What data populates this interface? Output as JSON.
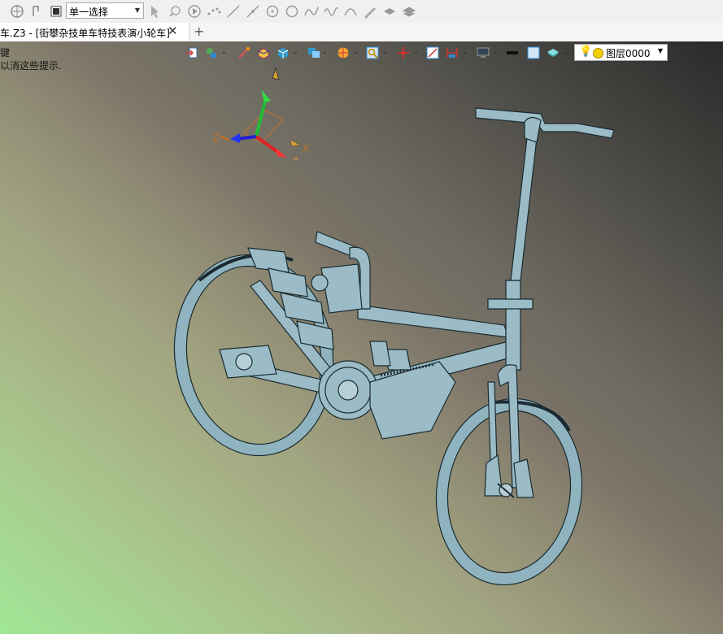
{
  "toolbar": {
    "select_value": "单一选择",
    "icons": [
      "globe-icon",
      "undo-icon",
      "stop-icon",
      "pointer-icon",
      "pick-icon",
      "play-icon",
      "points-icon",
      "line-icon",
      "line2-icon",
      "circle-dot-icon",
      "circle-icon",
      "curve-icon",
      "wave-icon",
      "arc-icon",
      "pen-icon",
      "layer-icon",
      "stack-icon"
    ]
  },
  "tabs": [
    {
      "title": "车.Z3 - [街攀杂技单车特技表演小轮车]",
      "close": "✕"
    }
  ],
  "add_tab": "+",
  "prompt": {
    "line1": "键",
    "line2": "以消这些提示."
  },
  "view_toolbar": {
    "layer_label": "图层0000"
  },
  "triad": {
    "x": "X",
    "z": "Z"
  },
  "colors": {
    "model": "#9bbcc6",
    "outline": "#1a2a30"
  }
}
